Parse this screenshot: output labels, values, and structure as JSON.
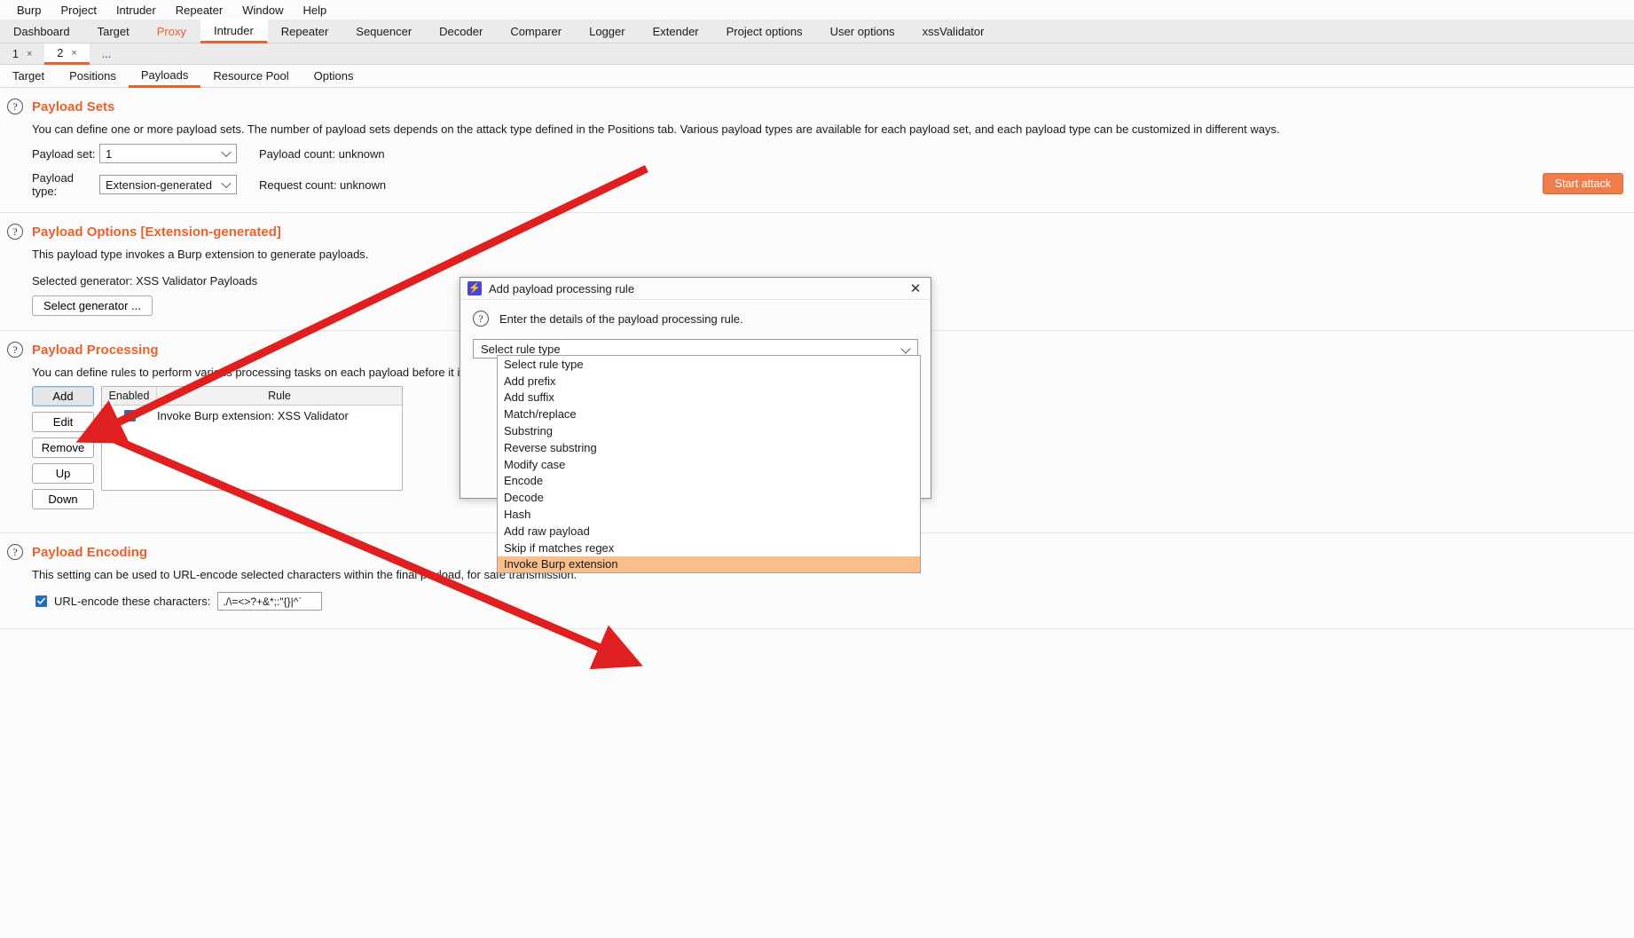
{
  "menubar": {
    "items": [
      "Burp",
      "Project",
      "Intruder",
      "Repeater",
      "Window",
      "Help"
    ]
  },
  "main_tabs": {
    "items": [
      "Dashboard",
      "Target",
      "Proxy",
      "Intruder",
      "Repeater",
      "Sequencer",
      "Decoder",
      "Comparer",
      "Logger",
      "Extender",
      "Project options",
      "User options",
      "xssValidator"
    ],
    "active": "Intruder",
    "accent_color": "#e8622c",
    "proxy_color": "#e8622c"
  },
  "attack_tabs": {
    "items": [
      {
        "label": "1",
        "close": "×"
      },
      {
        "label": "2",
        "close": "×"
      }
    ],
    "active": "2",
    "more": "..."
  },
  "sub_tabs": {
    "items": [
      "Target",
      "Positions",
      "Payloads",
      "Resource Pool",
      "Options"
    ],
    "active": "Payloads"
  },
  "start_attack": {
    "label": "Start attack",
    "color": "#ef7c4b"
  },
  "payload_sets": {
    "title": "Payload Sets",
    "help_icon": "question-icon",
    "description": "You can define one or more payload sets. The number of payload sets depends on the attack type defined in the Positions tab. Various payload types are available for each payload set, and each payload type can be customized in different ways.",
    "payload_set_label": "Payload set:",
    "payload_set_value": "1",
    "payload_count": "Payload count: unknown",
    "payload_type_label": "Payload type:",
    "payload_type_value": "Extension-generated",
    "request_count": "Request count: unknown"
  },
  "payload_options": {
    "title": "Payload Options [Extension-generated]",
    "description": "This payload type invokes a Burp extension to generate payloads.",
    "selected_generator": "Selected generator: XSS Validator Payloads",
    "select_generator_button": "Select generator ..."
  },
  "payload_processing": {
    "title": "Payload Processing",
    "description": "You can define rules to perform various processing tasks on each payload before it is used.",
    "buttons": [
      "Add",
      "Edit",
      "Remove",
      "Up",
      "Down"
    ],
    "focused_button": "Add",
    "table": {
      "columns": [
        "Enabled",
        "Rule"
      ],
      "rows": [
        {
          "enabled": true,
          "rule": "Invoke Burp extension: XSS Validator"
        }
      ]
    }
  },
  "payload_encoding": {
    "title": "Payload Encoding",
    "description": "This setting can be used to URL-encode selected characters within the final payload, for safe transmission.",
    "checkbox_checked": true,
    "checkbox_label": "URL-encode these characters:",
    "characters_value": "./\\=<>?+&*;:\"{}|^`"
  },
  "dialog": {
    "title": "Add payload processing rule",
    "icon": "burp-lightning-icon",
    "close_icon": "close-icon",
    "prompt": "Enter the details of the payload processing rule.",
    "combo_value": "Select rule type",
    "options": [
      "Select rule type",
      "Add prefix",
      "Add suffix",
      "Match/replace",
      "Substring",
      "Reverse substring",
      "Modify case",
      "Encode",
      "Decode",
      "Hash",
      "Add raw payload",
      "Skip if matches regex",
      "Invoke Burp extension"
    ],
    "selected_option": "Invoke Burp extension",
    "selected_color": "#fbbd8a"
  },
  "annotations": {
    "arrow_color": "#e02020",
    "count": 2
  }
}
